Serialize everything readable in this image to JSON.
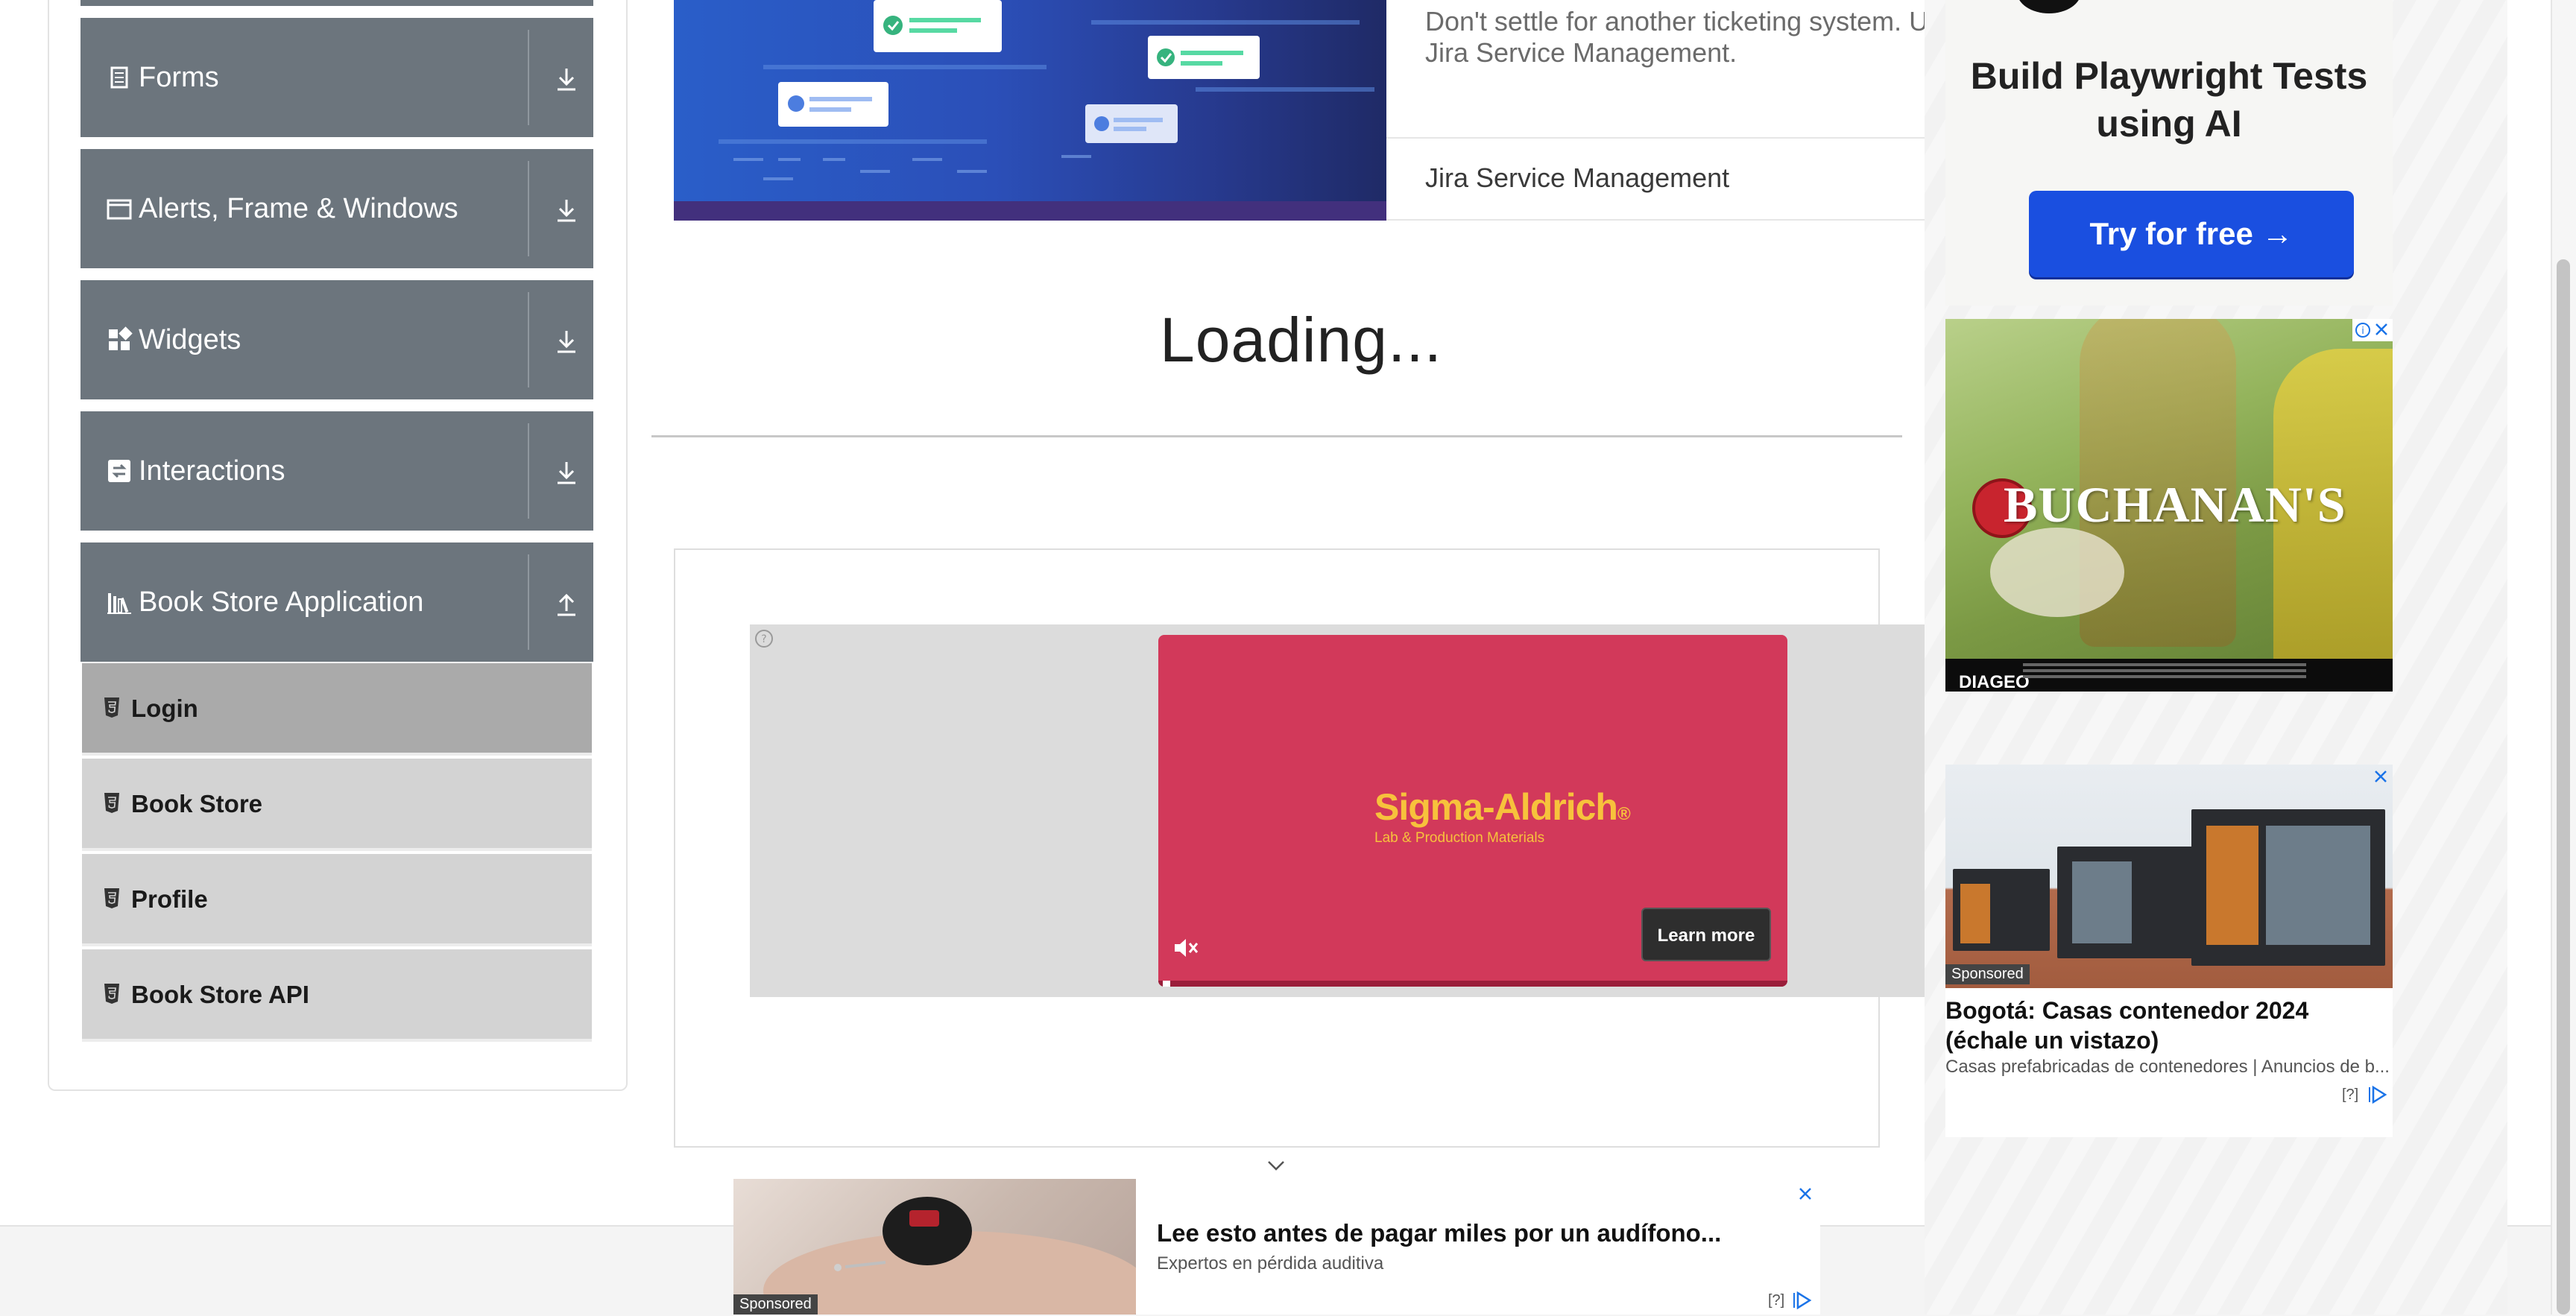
{
  "sidebar": {
    "groups": [
      {
        "label": "Forms",
        "icon": "form-icon",
        "expanded": false
      },
      {
        "label": "Alerts, Frame & Windows",
        "icon": "window-icon",
        "expanded": false
      },
      {
        "label": "Widgets",
        "icon": "widgets-icon",
        "expanded": false
      },
      {
        "label": "Interactions",
        "icon": "interactions-icon",
        "expanded": false
      },
      {
        "label": "Book Store Application",
        "icon": "bookshelf-icon",
        "expanded": true
      }
    ],
    "book_store_items": [
      {
        "label": "Login",
        "active": true
      },
      {
        "label": "Book Store",
        "active": false
      },
      {
        "label": "Profile",
        "active": false
      },
      {
        "label": "Book Store API",
        "active": false
      }
    ]
  },
  "main": {
    "jira_ad": {
      "description": "Don't settle for another ticketing system. U Jira Service Management.",
      "source": "Jira Service Management"
    },
    "loading_text": "Loading...",
    "video_ad": {
      "brand": "Sigma-Aldrich",
      "brand_mark": "®",
      "tagline": "Lab & Production Materials",
      "cta": "Learn more"
    },
    "bottom_ad": {
      "sponsored": "Sponsored",
      "headline": "Lee esto antes de pagar miles por un audífono...",
      "advertiser": "Expertos en pérdida auditiva",
      "help": "[?]"
    }
  },
  "right_sidebar": {
    "playwright_ad": {
      "headline": "Build Playwright Tests using AI",
      "cta": "Try for free →",
      "cta_color": "#1a4fe0"
    },
    "buchanans_ad": {
      "brand": "BUCHANAN'S",
      "footer_brand": "DIAGEO"
    },
    "casas_ad": {
      "sponsored": "Sponsored",
      "title": "Bogotá: Casas contenedor 2024 (échale un vistazo)",
      "subtitle": "Casas prefabricadas de contenedores | Anuncios de b...",
      "help": "[?]"
    }
  },
  "colors": {
    "sidebar_group_bg": "#6c757d",
    "sidebar_item_bg": "#d3d3d3",
    "sidebar_item_active_bg": "#aaaaaa",
    "sigma_bg": "#d2395a",
    "sigma_text": "#f7c23c"
  }
}
